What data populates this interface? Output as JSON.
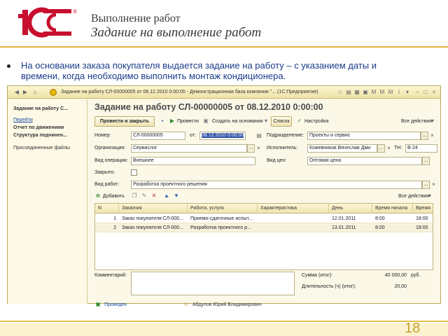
{
  "slide": {
    "title_line1": "Выполнение работ",
    "title_line2": "Задание на выполнение работ",
    "bullet": "На основании заказа покупателя выдается задание на работу – с указанием даты и времени, когда необходимо выполнить  монтаж кондиционера.",
    "page_number": "18",
    "colors": {
      "logo_red": "#c8102e",
      "accent_line": "#e0b43c",
      "bullet_text": "#1a3a8a"
    }
  },
  "window": {
    "title": "Задание на работу СЛ-00000005 от 08.12.2010 0:00:00 - Демонстрационная база компании \"... (1С:Предприятие)",
    "titlebar_icons": [
      "back-icon",
      "forward-icon",
      "favorites-icon",
      "history-icon",
      "calculator-icon",
      "calendar-icon",
      "memory-icon",
      "memory-plus-icon",
      "zoom-icon",
      "info-icon",
      "menu-icon",
      "minimize-icon",
      "maximize-icon",
      "close-icon"
    ]
  },
  "sidebar": {
    "header": "Задание на работу С...",
    "goto_label": "Перейти",
    "links": [
      "Отчет по движениям",
      "Структура подчинен..."
    ],
    "attached": "Присоединенные файлы"
  },
  "form": {
    "heading": "Задание на работу СЛ-00000005 от 08.12.2010 0:00:00",
    "toolbar": {
      "post_close": "Провести и закрыть",
      "post": "Провести",
      "create_based": "Создать на основании",
      "list": "Список",
      "settings": "Настройка",
      "all_actions": "Все действия"
    },
    "number_label": "Номер:",
    "number_value": "СЛ-00000005",
    "from_label": "от:",
    "date_value": "08.12.2010  0:00:00",
    "division_label": "Подразделение:",
    "division_value": "Проекты и сервис",
    "org_label": "Организация:",
    "org_value": "Сервислог",
    "executor_label": "Исполнитель:",
    "executor_value": "Кожевников Вячеслав Дми",
    "tn_label": "ТН:",
    "tn_value": "В-24",
    "operation_label": "Вид операции:",
    "operation_value": "Внешнее",
    "price_label": "Вид цен:",
    "price_value": "Оптовая цена",
    "closed_label": "Закрыто:",
    "work_type_label": "Вид работ:",
    "work_type_value": "Разработка проектного решения",
    "table_toolbar": {
      "add": "Добавить",
      "all_actions": "Все действия"
    },
    "table": {
      "columns": [
        "N",
        "Заказчик",
        "Работа, услуга",
        "Характеристика",
        "День",
        "Время начала",
        "Время"
      ],
      "rows": [
        [
          "1",
          "Заказ покупателя СЛ-000...",
          "Приемо-сдаточные испыт...",
          "",
          "12.01.2011",
          "8:00",
          "18:00"
        ],
        [
          "2",
          "Заказ покупателя СЛ-000...",
          "Разработка проектного р...",
          "",
          "13.01.2011",
          "8:00",
          "18:00"
        ]
      ]
    },
    "comment_label": "Комментарий:",
    "sum_label": "Сумма (итог):",
    "sum_value": "40 000,00",
    "sum_unit": "руб.",
    "duration_label": "Длительность (ч) (итог):",
    "duration_value": "20,00",
    "status_posted": "Проведен",
    "author": "Абдулов Юрий Владимирович"
  }
}
